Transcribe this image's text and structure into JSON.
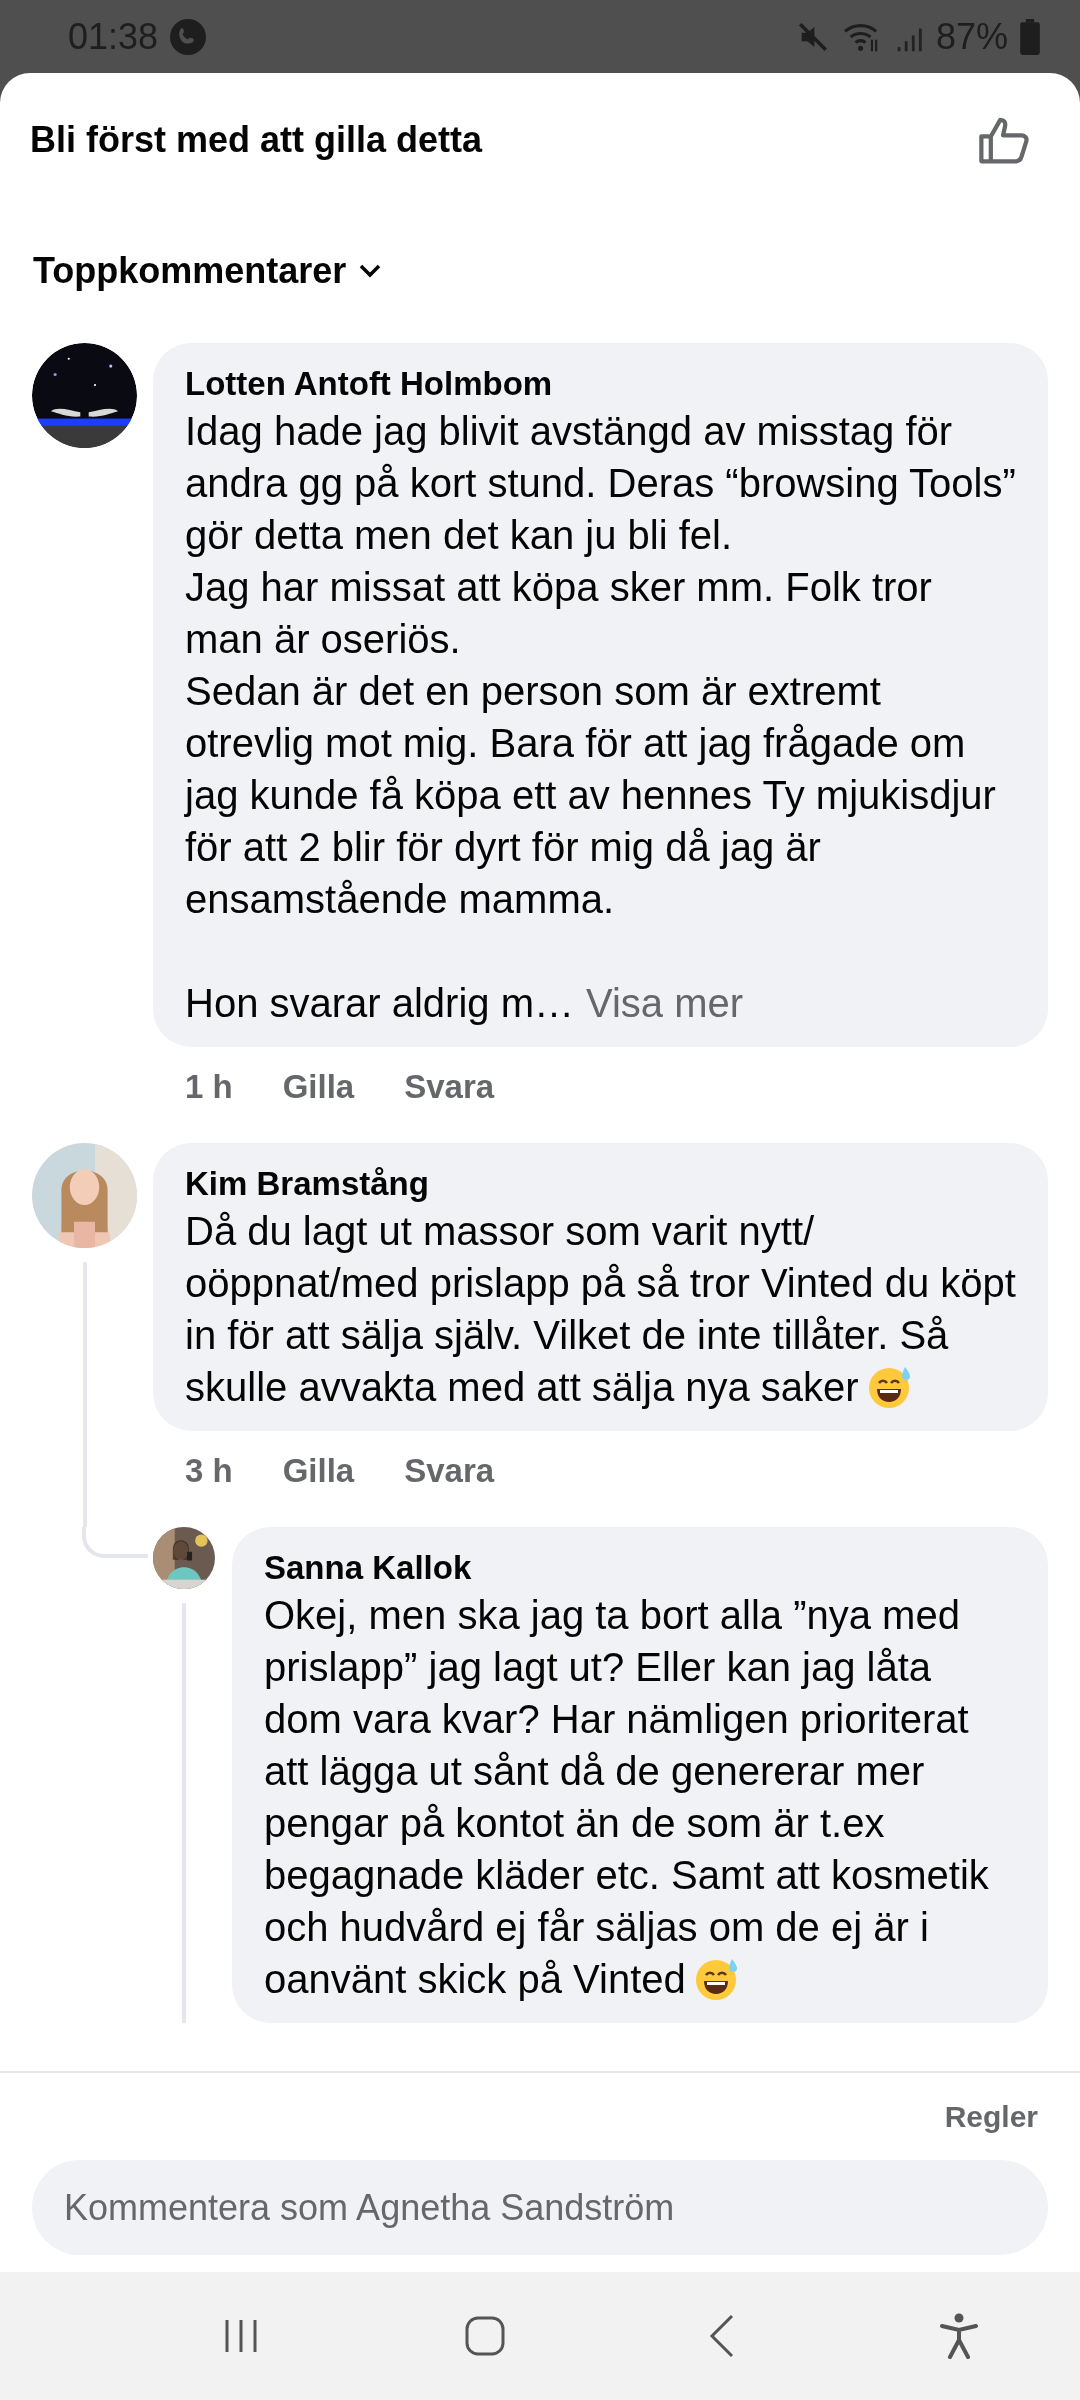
{
  "status_bar": {
    "time": "01:38",
    "battery": "87%"
  },
  "header": {
    "title": "Bli först med att gilla detta"
  },
  "sort": {
    "label": "Toppkommentarer"
  },
  "comments": [
    {
      "author": "Lotten Antoft Holmbom",
      "text": "Idag hade jag blivit avstängd av misstag för andra gg på kort stund. Deras “browsing Tools” gör detta men det kan ju bli fel.\nJag har missat att köpa sker mm. Folk tror man är oseriös.\nSedan är det en person som är extremt otrevlig mot mig. Bara för att jag frågade om jag kunde få köpa ett av hennes Ty mjukisdjur för att 2 blir för dyrt för mig då jag är ensamstående mamma.\n\nHon svarar aldrig m…",
      "see_more": "Visa mer",
      "ends_with_emoji": false,
      "time": "1 h",
      "actions": [
        "Gilla",
        "Svara"
      ]
    },
    {
      "author": "Kim Bramstång",
      "text": "Då du lagt ut massor som varit nytt/ oöppnat/med prislapp på så tror Vinted du köpt in för att sälja själv. Vilket de inte tillåter. Så skulle avvakta med att sälja nya saker",
      "ends_with_emoji": true,
      "time": "3 h",
      "actions": [
        "Gilla",
        "Svara"
      ],
      "children": [
        {
          "author": "Sanna Kallok",
          "text": "Okej, men ska jag ta bort alla ”nya med prislapp”  jag lagt ut? Eller kan jag låta dom vara kvar? Har nämligen prioriterat att lägga ut sånt då de genererar mer pengar på kontot än de som är t.ex begagnade kläder etc. Samt att kosmetik och hudvård ej får säljas om de ej är i oanvänt skick på Vinted",
          "ends_with_emoji": true
        }
      ]
    }
  ],
  "footer": {
    "rules_link": "Regler",
    "comment_field": {
      "placeholder": "Kommentera som Agnetha Sandström"
    }
  }
}
